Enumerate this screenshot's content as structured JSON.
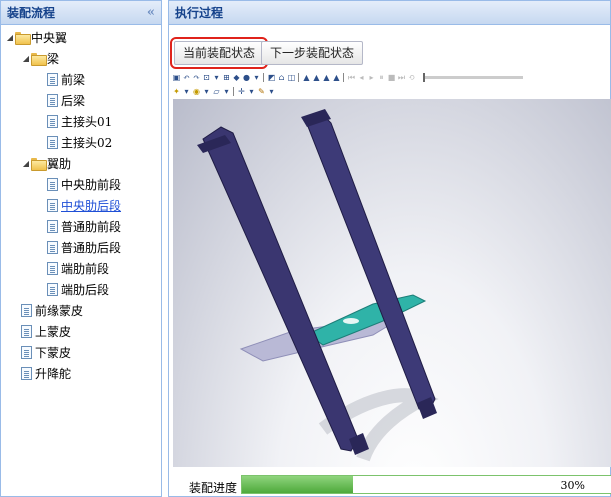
{
  "left_panel": {
    "title": "装配流程",
    "collapse_icon": "double-chevron-left-icon"
  },
  "tree": {
    "root": "中央翼",
    "liang": "梁",
    "qianliang": "前梁",
    "houliang": "后梁",
    "zhujietou01": "主接头01",
    "zhujietou02": "主接头02",
    "yilei": "翼肋",
    "zhongyangleiqian": "中央肋前段",
    "zhongyangleihou": "中央肋后段",
    "putongleiqian": "普通肋前段",
    "putongleihou": "普通肋后段",
    "duanleiqian": "端肋前段",
    "duanleihou": "端肋后段",
    "qianyuanmengpi": "前缘蒙皮",
    "shangmengpi": "上蒙皮",
    "xiamengpi": "下蒙皮",
    "shengjiangduo": "升降舵"
  },
  "right_panel": {
    "title": "执行过程",
    "current_button": "当前装配状态",
    "next_button": "下一步装配状态"
  },
  "progress": {
    "label": "装配进度",
    "value": 0.3,
    "text": "30%"
  },
  "colors": {
    "header_text": "#15428b",
    "selected_link": "#1f4fd6",
    "highlight_outline": "#e0231b",
    "progress_fill": "#4ea93b",
    "beam": "#3a3670",
    "rib": "#2fb3a8"
  }
}
